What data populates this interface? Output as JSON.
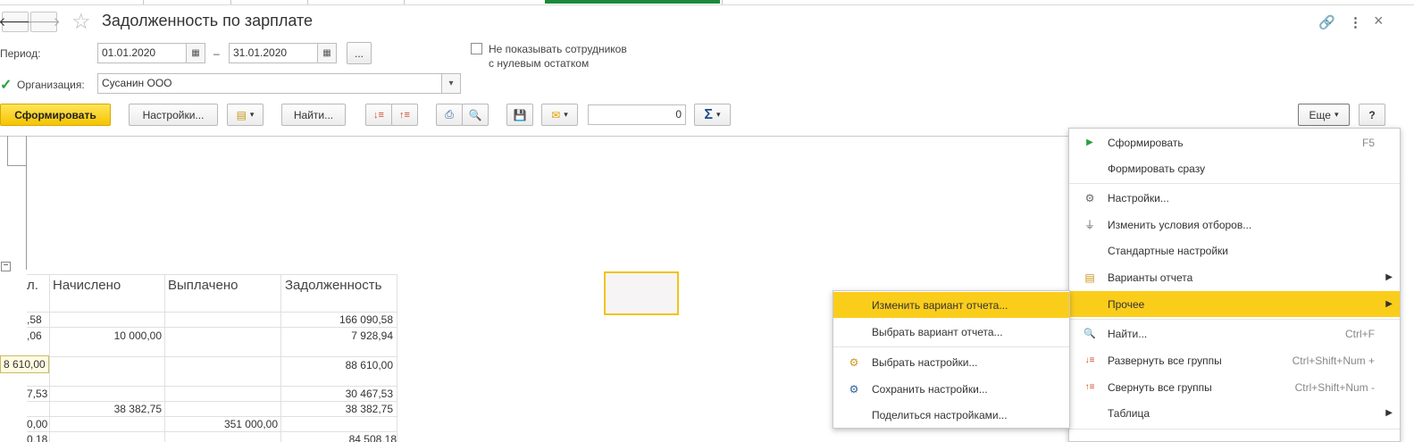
{
  "window": {
    "title": "Задолженность по зарплате",
    "back_icon": "🡐",
    "forward_icon": "🡒",
    "star_icon": "☆",
    "link_icon": "🔗",
    "more_icon": "⋮",
    "close_icon": "×"
  },
  "form": {
    "period_label": "Период:",
    "date_from": "01.01.2020",
    "date_to": "31.01.2020",
    "dash": "–",
    "ellipsis": "...",
    "zero_balance_line1": "Не показывать сотрудников",
    "zero_balance_line2": "с нулевым остатком",
    "org_label": "Организация:",
    "org_value": "Сусанин ООО",
    "org_checked": true
  },
  "toolbar": {
    "generate": "Сформировать",
    "settings": "Настройки...",
    "find": "Найти...",
    "sum_value": "0",
    "sigma": "Σ",
    "more": "Еще",
    "help": "?"
  },
  "table": {
    "headers": [
      "Начислено",
      "Выплачено",
      "Задолженность"
    ],
    "partial_header": "л.",
    "rows": [
      {
        "c0": ",58",
        "c1": "",
        "c2": "",
        "c3": "166 090,58"
      },
      {
        "c0": ",06",
        "c1": "10 000,00",
        "c2": "",
        "c3": "7 928,94"
      },
      {
        "c0": "",
        "c1": "",
        "c2": "",
        "c3": "88 610,00"
      },
      {
        "c0": "7,53",
        "c1": "",
        "c2": "",
        "c3": "30 467,53"
      },
      {
        "c0": "",
        "c1": "38 382,75",
        "c2": "",
        "c3": "38 382,75"
      },
      {
        "c0": "0,00",
        "c1": "",
        "c2": "351 000,00",
        "c3": ""
      },
      {
        "c0": "0,18",
        "c1": "",
        "c2": "",
        "c3": "84 508,18"
      }
    ],
    "tooltip": "8 610,00"
  },
  "menu": {
    "items": [
      {
        "icon": "▶",
        "label": "Сформировать",
        "shortcut": "F5"
      },
      {
        "icon": "",
        "label": "Формировать сразу",
        "shortcut": ""
      },
      {
        "icon": "⚙",
        "label": "Настройки...",
        "shortcut": ""
      },
      {
        "icon": "⏚",
        "label": "Изменить условия отборов...",
        "shortcut": ""
      },
      {
        "icon": "",
        "label": "Стандартные настройки",
        "shortcut": ""
      },
      {
        "icon": "▤",
        "label": "Варианты отчета",
        "shortcut": "",
        "arrow": "▶"
      },
      {
        "icon": "",
        "label": "Прочее",
        "shortcut": "",
        "arrow": "▶"
      },
      {
        "icon": "🔍",
        "label": "Найти...",
        "shortcut": "Ctrl+F"
      },
      {
        "icon": "↓≡",
        "label": "Развернуть все группы",
        "shortcut": "Ctrl+Shift+Num +"
      },
      {
        "icon": "↑≡",
        "label": "Свернуть все группы",
        "shortcut": "Ctrl+Shift+Num -"
      },
      {
        "icon": "",
        "label": "Таблица",
        "shortcut": "",
        "arrow": "▶"
      }
    ]
  },
  "submenu": {
    "items": [
      {
        "icon": "",
        "label": "Изменить вариант отчета..."
      },
      {
        "icon": "",
        "label": "Выбрать вариант отчета..."
      },
      {
        "icon": "⚙",
        "label": "Выбрать настройки..."
      },
      {
        "icon": "⚙",
        "label": "Сохранить настройки..."
      },
      {
        "icon": "",
        "label": "Поделиться настройками..."
      }
    ]
  },
  "colors": {
    "accent_yellow": "#fbcd1b",
    "active_tab": "#1d8a3a",
    "checkmark": "#2e9e3e"
  }
}
